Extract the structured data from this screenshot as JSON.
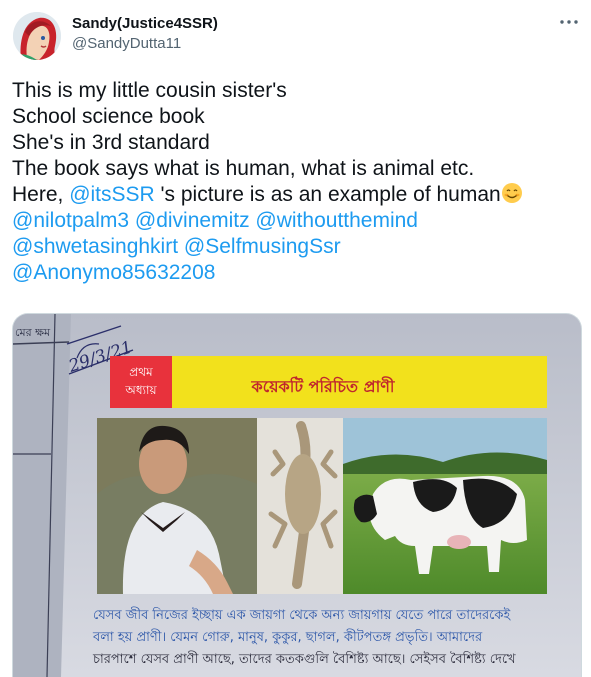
{
  "author": {
    "display_name": "Sandy(Justice4SSR)",
    "handle": "@SandyDutta11"
  },
  "more_icon": "more-horizontal-icon",
  "tweet": {
    "line1": "This is my little cousin sister's",
    "line2": "School science book",
    "line3": "She's in 3rd standard",
    "line4": "The book says what is human, what is animal etc.",
    "line5_pre": "Here, ",
    "line5_mention": "@itsSSR",
    "line5_post": " 's picture is as an example of human",
    "emoji": "smiling-face-emoji",
    "mentions_row1": [
      "@nilotpalm3",
      "@divinemitz",
      "@withoutthemind"
    ],
    "mentions_row2": [
      "@shwetasinghkirt",
      "@SelfmusingSsr"
    ],
    "mentions_row3": [
      "@Anonymo85632208"
    ]
  },
  "book": {
    "date_note": "29/3/21",
    "chapter_label_1": "প্রথম",
    "chapter_label_2": "অধ্যায়",
    "chapter_title": "কয়েকটি পরিচিত প্রাণী",
    "margin_text": "মের ক্ষম",
    "caption_line1": "যেসব জীব নিজের ইচ্ছায় এক জায়গা থেকে অন্য জায়গায় যেতে পারে তাদেরকেই",
    "caption_line2": "বলা হয় প্রাণী। যেমন গোরু, মানুষ, কুকুর, ছাগল, কীটপতঙ্গ প্রভৃতি। আমাদের",
    "caption_line3": "চারপাশে যেসব প্রাণী আছে, তাদের কতকগুলি বৈশিষ্ট্য আছে। সেইসব বৈশিষ্ট্য দেখে"
  },
  "colors": {
    "mention": "#1d9bf0",
    "title_band": "#f2e11c",
    "chapter_box": "#e8323c",
    "page": "#c9cdd6"
  }
}
